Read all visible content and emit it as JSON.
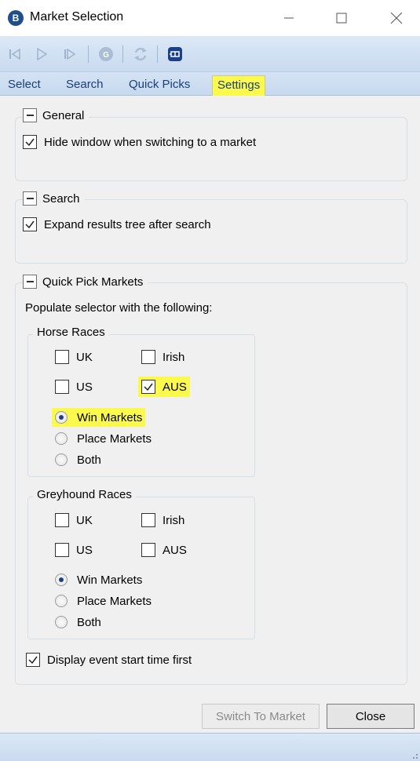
{
  "window": {
    "title": "Market Selection",
    "icon_letter": "B",
    "controls": [
      "minimize-icon",
      "maximize-icon",
      "close-icon"
    ]
  },
  "toolbar": {
    "icons": [
      "skip-back-icon",
      "play-icon",
      "skip-forward-icon",
      "go-icon",
      "refresh-icon",
      "pin-icon"
    ]
  },
  "tabs": [
    {
      "label": "Select",
      "active": false
    },
    {
      "label": "Search",
      "active": false
    },
    {
      "label": "Quick Picks",
      "active": false
    },
    {
      "label": "Settings",
      "active": true
    }
  ],
  "general": {
    "heading": "General",
    "hide_window": {
      "label": "Hide window when switching to a market",
      "checked": true
    }
  },
  "search": {
    "heading": "Search",
    "expand_tree": {
      "label": "Expand results tree after search",
      "checked": true
    }
  },
  "quick_pick": {
    "heading": "Quick Pick Markets",
    "description": "Populate selector with the following:",
    "horse": {
      "heading": "Horse Races",
      "uk": {
        "label": "UK",
        "checked": false
      },
      "irish": {
        "label": "Irish",
        "checked": false
      },
      "us": {
        "label": "US",
        "checked": false
      },
      "aus": {
        "label": "AUS",
        "checked": true
      },
      "win": {
        "label": "Win Markets",
        "selected": true
      },
      "place": {
        "label": "Place Markets",
        "selected": false
      },
      "both": {
        "label": "Both",
        "selected": false
      }
    },
    "greyhound": {
      "heading": "Greyhound Races",
      "uk": {
        "label": "UK",
        "checked": false
      },
      "irish": {
        "label": "Irish",
        "checked": false
      },
      "us": {
        "label": "US",
        "checked": false
      },
      "aus": {
        "label": "AUS",
        "checked": false
      },
      "win": {
        "label": "Win Markets",
        "selected": true
      },
      "place": {
        "label": "Place Markets",
        "selected": false
      },
      "both": {
        "label": "Both",
        "selected": false
      }
    },
    "display_start_time": {
      "label": "Display event start time first",
      "checked": true
    }
  },
  "buttons": {
    "switch": "Switch To Market",
    "close": "Close"
  },
  "colors": {
    "highlight": "#fbf94c",
    "toolbar": "#c9dbef",
    "tab_text": "#1a3f7a"
  }
}
